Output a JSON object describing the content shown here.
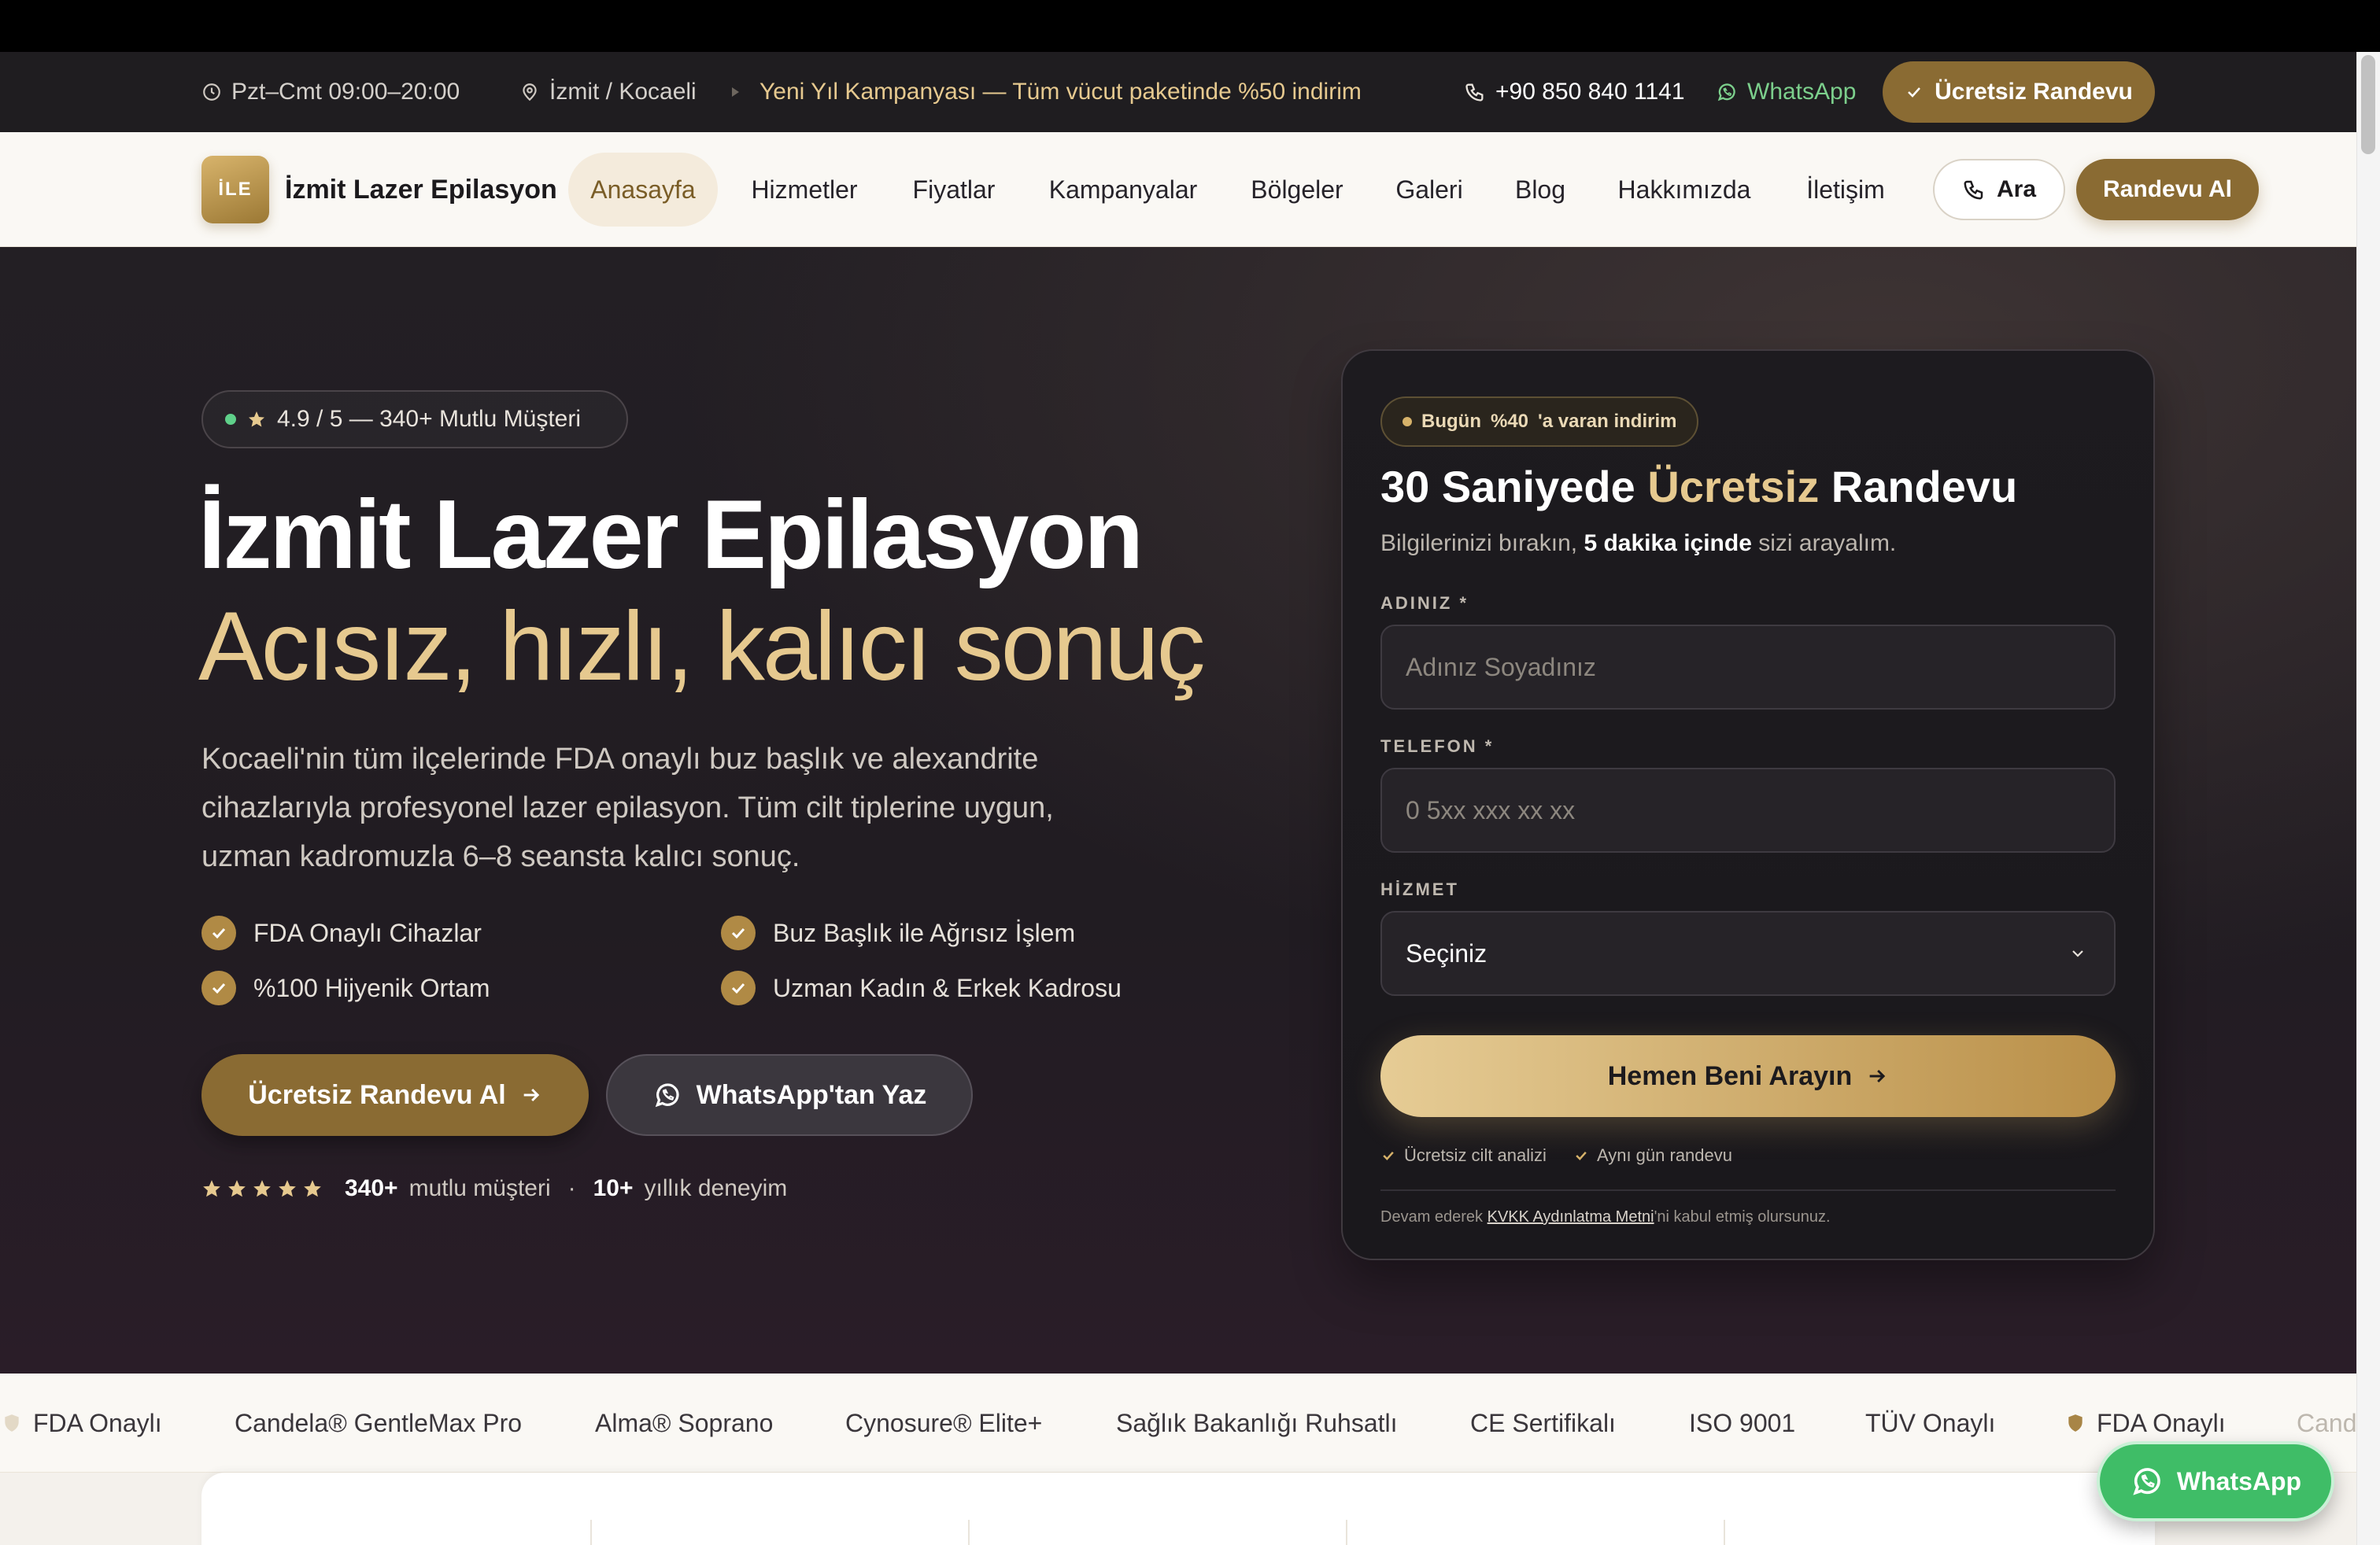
{
  "topbar": {
    "hours": "Pzt–Cmt 09:00–20:00",
    "location": "İzmit / Kocaeli",
    "promo": "Yeni Yıl Kampanyası — Tüm vücut paketinde %50 indirim",
    "phone": "+90 850 840 1141",
    "whatsapp": "WhatsApp",
    "cta": "Ücretsiz Randevu"
  },
  "nav": {
    "logo_badge": "İLE",
    "brand": "İzmit Lazer Epilasyon",
    "links": [
      "Anasayfa",
      "Hizmetler",
      "Fiyatlar",
      "Kampanyalar",
      "Bölgeler",
      "Galeri",
      "Blog",
      "Hakkımızda",
      "İletişim"
    ],
    "active": "Anasayfa",
    "call": "Ara",
    "cta": "Randevu Al"
  },
  "hero": {
    "rating": "4.9 / 5 — 340+ Mutlu Müşteri",
    "title": "İzmit Lazer Epilasyon",
    "subtitle": "Acısız, hızlı, kalıcı sonuç",
    "description": "Kocaeli'nin tüm ilçelerinde FDA onaylı buz başlık ve alexandrite cihazlarıyla profesyonel lazer epilasyon. Tüm cilt tiplerine uygun, uzman kadromuzla 6–8 seansta kalıcı sonuç.",
    "features": [
      "FDA Onaylı Cihazlar",
      "Buz Başlık ile Ağrısız İşlem",
      "%100 Hijyenik Ortam",
      "Uzman Kadın & Erkek Kadrosu"
    ],
    "cta_primary": "Ücretsiz Randevu Al",
    "cta_whatsapp": "WhatsApp'tan Yaz",
    "stats": {
      "customers_num": "340+",
      "customers_text": "mutlu müşteri",
      "separator": "·",
      "years_num": "10+",
      "years_text": "yıllık deneyim"
    }
  },
  "form": {
    "badge_pre": "Bugün",
    "badge_value": "%40",
    "badge_post": "'a varan indirim",
    "title_pre": "30 Saniyede",
    "title_highlight": "Ücretsiz",
    "title_post": "Randevu",
    "sub_pre": "Bilgilerinizi bırakın,",
    "sub_strong": "5 dakika içinde",
    "sub_post": "sizi arayalım.",
    "name_label": "ADINIZ *",
    "name_placeholder": "Adınız Soyadınız",
    "phone_label": "TELEFON *",
    "phone_placeholder": "0 5xx xxx xx xx",
    "service_label": "HİZMET",
    "service_value": "Seçiniz",
    "submit": "Hemen Beni Arayın",
    "perk1": "Ücretsiz cilt analizi",
    "perk2": "Aynı gün randevu",
    "kvkk_pre": "Devam ederek",
    "kvkk_link": "KVKK Aydınlatma Metni",
    "kvkk_post": "'ni kabul etmiş olursunuz."
  },
  "logo_strip": [
    "FDA Onaylı",
    "Candela® GentleMax Pro",
    "Alma® Soprano",
    "Cynosure® Elite+",
    "Sağlık Bakanlığı Ruhsatlı",
    "CE Sertifikalı",
    "ISO 9001",
    "TÜV Onaylı",
    "FDA Onaylı",
    "Cand"
  ],
  "floating_whatsapp": "WhatsApp",
  "colors": {
    "gold": "#8a6b33",
    "gold_light": "#e6c98f",
    "hero_bg": "#231f24",
    "whatsapp_green": "#3fbd67"
  },
  "icons": [
    "clock-icon",
    "map-pin-icon",
    "phone-icon",
    "whatsapp-icon",
    "check-icon",
    "star-icon",
    "arrow-right-icon",
    "chevron-down-icon",
    "shield-icon"
  ]
}
